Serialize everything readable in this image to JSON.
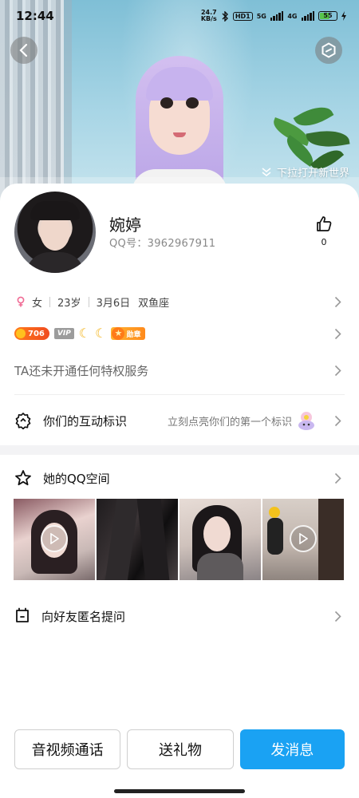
{
  "status_bar": {
    "time": "12:44",
    "net_speed_value": "24.7",
    "net_speed_unit": "KB/s",
    "hd_label": "HD1",
    "sig1_label": "5G",
    "sig2_label": "4G",
    "battery": "55"
  },
  "hero": {
    "pull_hint": "下拉打开新世界",
    "back_icon": "chevron-left-icon",
    "zplan_icon": "hexagon-icon"
  },
  "profile": {
    "nickname": "婉婷",
    "qq_id": "QQ号：3962967911",
    "like_count": "0"
  },
  "info": {
    "gender": "女",
    "age": "23岁",
    "birthday": "3月6日",
    "zodiac": "双鱼座"
  },
  "badges": {
    "level": "706",
    "vip": "VIP",
    "medal": "勋章"
  },
  "privilege_text": "TA还未开通任何特权服务",
  "interaction": {
    "label": "你们的互动标识",
    "hint": "立刻点亮你们的第一个标识"
  },
  "qzone": {
    "label": "她的QQ空间"
  },
  "ask": {
    "label": "向好友匿名提问"
  },
  "actions": {
    "call": "音视频通话",
    "gift": "送礼物",
    "message": "发消息"
  },
  "colors": {
    "primary_button": "#1aa2f3",
    "gender_icon": "#f06a94",
    "level_badge": "#f04b20"
  }
}
